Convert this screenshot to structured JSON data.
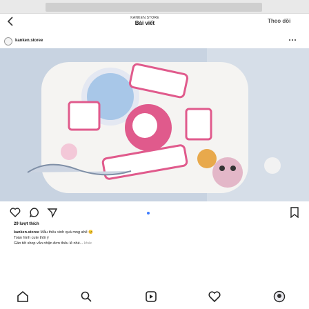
{
  "header": {
    "account_handle": "KANKEN.STORE",
    "title": "Bài viết",
    "follow_label": "Theo dõi",
    "back_icon": "chevron-left-icon"
  },
  "author": {
    "username": "kanken.storee",
    "more_icon": "more-horizontal-icon"
  },
  "post": {
    "likes": "29 lượt thích",
    "caption_user": "kanken.storee",
    "caption_line1": "Mẫu thêu xinh quá mng ahể 😊",
    "caption_line2": "Toàn hình cute thôi ý",
    "caption_line3": "Gần tết shop vẫn nhận đơn thêu lẻ nhé...",
    "caption_more": "khác",
    "accent_color": "#3d7cff"
  },
  "tabbar": {
    "items": [
      "home-icon",
      "search-icon",
      "reels-icon",
      "heart-icon",
      "profile-icon"
    ]
  }
}
